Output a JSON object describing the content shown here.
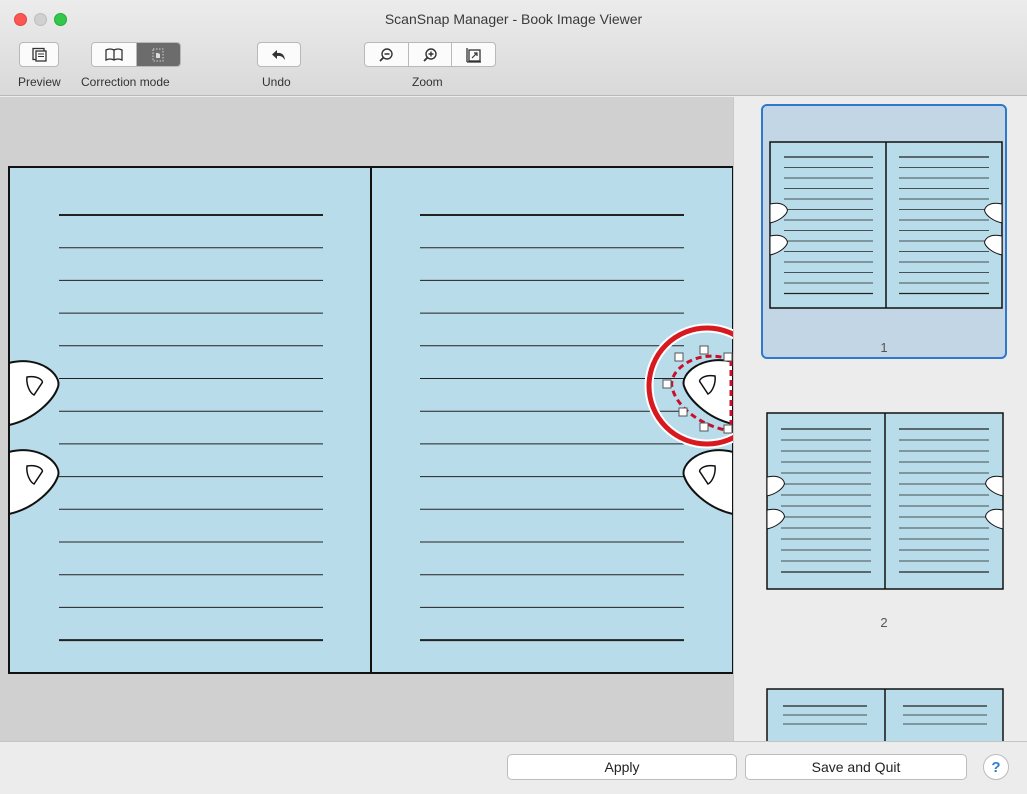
{
  "window": {
    "title": "ScanSnap Manager - Book Image Viewer"
  },
  "toolbar": {
    "preview_label": "Preview",
    "correction_mode_label": "Correction mode",
    "undo_label": "Undo",
    "zoom_label": "Zoom",
    "icons": {
      "preview": "preview-icon",
      "book_mode": "book-icon",
      "finger_mode": "finger-point-icon",
      "undo": "undo-arrow-icon",
      "zoom_out": "zoom-out-icon",
      "zoom_in": "zoom-in-icon",
      "fit": "fit-page-icon"
    }
  },
  "thumbnails": [
    {
      "page_number": "1",
      "selected": true
    },
    {
      "page_number": "2",
      "selected": false
    },
    {
      "page_number": "",
      "selected": false
    }
  ],
  "footer": {
    "apply_label": "Apply",
    "save_quit_label": "Save and Quit",
    "help_label": "?"
  },
  "colors": {
    "page_fill": "#b9dcea",
    "selection_border": "#2e78d0",
    "highlight_ring": "#d71920"
  }
}
